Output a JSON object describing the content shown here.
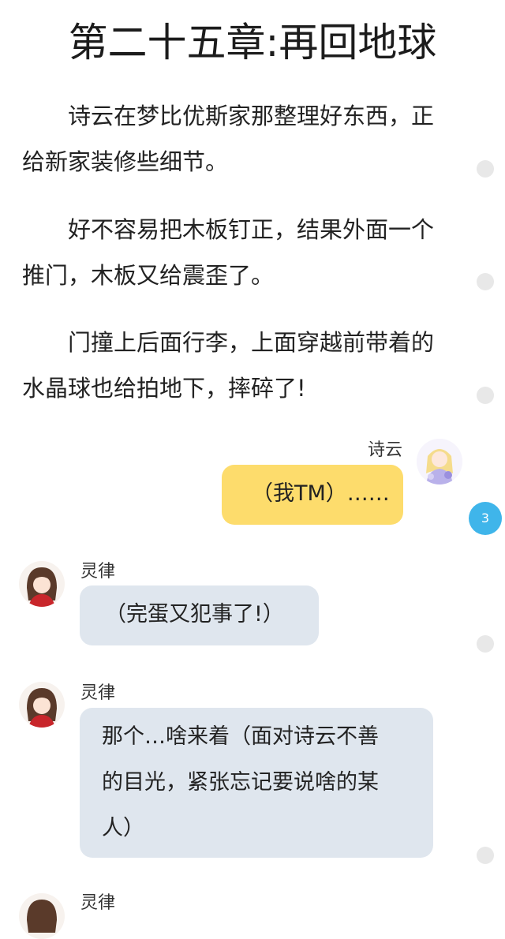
{
  "chapter": {
    "title": "第二十五章:再回地球"
  },
  "paragraphs": [
    {
      "line1": "诗云在梦比优斯家那整理好东西，正",
      "line2": "给新家装修些细节。"
    },
    {
      "line1": "好不容易把木板钉正，结果外面一个",
      "line2": "推门，木板又给震歪了。"
    },
    {
      "line1": "门撞上后面行李，上面穿越前带着的",
      "line2": "水晶球也给拍地下，摔碎了!"
    }
  ],
  "messages": [
    {
      "speaker": "诗云",
      "text": "（我TM）……",
      "side": "right"
    },
    {
      "speaker": "灵律",
      "text": "（完蛋又犯事了!）",
      "side": "left"
    },
    {
      "speaker": "灵律",
      "line1": "那个…啥来着（面对诗云不善",
      "line2": "的目光，紧张忘记要说啥的某",
      "line3": "人）",
      "side": "left"
    },
    {
      "speaker": "灵律",
      "side": "left"
    }
  ],
  "comment_badge": {
    "count": "3"
  },
  "colors": {
    "badge": "#3fb5ea",
    "bubble_self": "#fddc6c",
    "bubble_other": "#dfe6ee",
    "comment_dot": "#e8e8e8"
  }
}
